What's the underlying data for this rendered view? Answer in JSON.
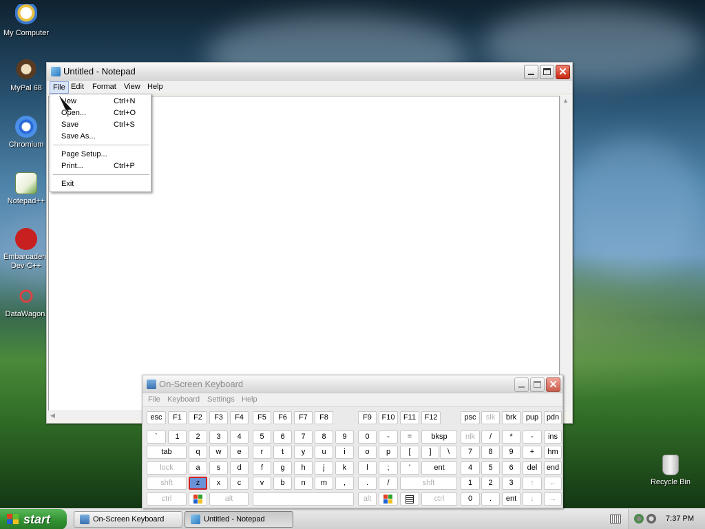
{
  "desktop": {
    "icons": [
      {
        "label": "My Computer"
      },
      {
        "label": "MyPal 68"
      },
      {
        "label": "Chromium"
      },
      {
        "label": "Notepad++"
      },
      {
        "label": "Embarcadero Dev-C++"
      },
      {
        "label": "DataWagon."
      },
      {
        "label": "Recycle Bin"
      }
    ]
  },
  "notepad": {
    "title": "Untitled - Notepad",
    "menu": [
      "File",
      "Edit",
      "Format",
      "View",
      "Help"
    ],
    "file_menu": [
      {
        "label": "New",
        "shortcut": "Ctrl+N"
      },
      {
        "label": "Open...",
        "shortcut": "Ctrl+O"
      },
      {
        "label": "Save",
        "shortcut": "Ctrl+S"
      },
      {
        "label": "Save As...",
        "shortcut": ""
      },
      {
        "label": "Page Setup...",
        "shortcut": ""
      },
      {
        "label": "Print...",
        "shortcut": "Ctrl+P"
      },
      {
        "label": "Exit",
        "shortcut": ""
      }
    ]
  },
  "osk": {
    "title": "On-Screen Keyboard",
    "menu": [
      "File",
      "Keyboard",
      "Settings",
      "Help"
    ],
    "rows": {
      "r1": [
        "esc",
        "F1",
        "F2",
        "F3",
        "F4",
        "F5",
        "F6",
        "F7",
        "F8",
        "F9",
        "F10",
        "F11",
        "F12",
        "psc",
        "slk",
        "brk",
        "pup",
        "pdn"
      ],
      "r2": [
        "`",
        "1",
        "2",
        "3",
        "4",
        "5",
        "6",
        "7",
        "8",
        "9",
        "0",
        "-",
        "=",
        "bksp",
        "nlk",
        "/",
        "*",
        "-",
        "ins"
      ],
      "r3": [
        "tab",
        "q",
        "w",
        "e",
        "r",
        "t",
        "y",
        "u",
        "i",
        "o",
        "p",
        "[",
        "]",
        "\\",
        "7",
        "8",
        "9",
        "+",
        "hm"
      ],
      "r4": [
        "lock",
        "a",
        "s",
        "d",
        "f",
        "g",
        "h",
        "j",
        "k",
        "l",
        ";",
        "'",
        "ent",
        "4",
        "5",
        "6",
        "del",
        "end"
      ],
      "r5": [
        "shft",
        "z",
        "x",
        "c",
        "v",
        "b",
        "n",
        "m",
        ",",
        ".",
        "/",
        "shft",
        "1",
        "2",
        "3",
        "↑",
        "←"
      ],
      "r6": [
        "ctrl",
        "",
        "alt",
        "",
        "alt",
        "",
        "",
        "ctrl",
        "0",
        ".",
        "ent",
        "↓",
        "→"
      ]
    }
  },
  "taskbar": {
    "start": "start",
    "tasks": [
      "On-Screen Keyboard",
      "Untitled - Notepad"
    ],
    "clock": "7:37 PM"
  },
  "colors": {
    "start_green": "#3a9a3a",
    "selected_key": "#6a92d8",
    "selected_key_border": "#d02020",
    "close_red": "#c82810"
  }
}
